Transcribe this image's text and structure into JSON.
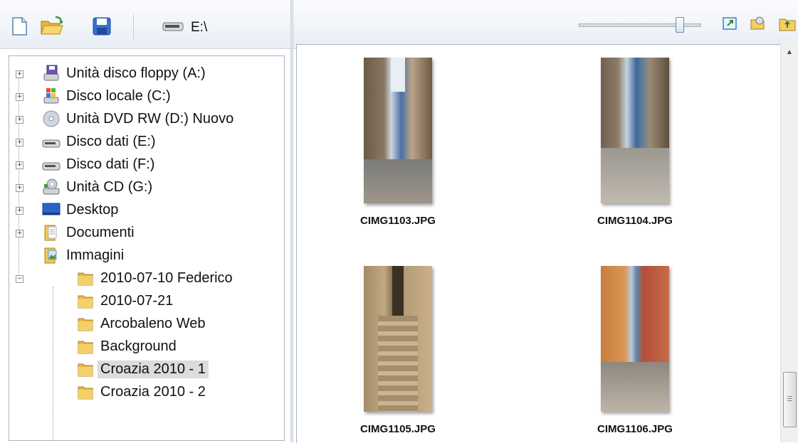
{
  "toolbar": {
    "new_icon": "new-file-icon",
    "open_icon": "open-folder-icon",
    "save_icon": "save-disk-icon",
    "drive_label": "E:\\"
  },
  "tree": {
    "items": [
      {
        "label": "Unità disco floppy (A:)",
        "icon": "floppy-drive-icon"
      },
      {
        "label": "Disco locale (C:)",
        "icon": "windows-drive-icon"
      },
      {
        "label": "Unità DVD RW (D:) Nuovo",
        "icon": "dvd-drive-icon"
      },
      {
        "label": "Disco dati (E:)",
        "icon": "hard-drive-icon"
      },
      {
        "label": "Disco dati (F:)",
        "icon": "hard-drive-icon"
      },
      {
        "label": "Unità CD (G:)",
        "icon": "cd-drive-icon"
      },
      {
        "label": "Desktop",
        "icon": "desktop-icon"
      },
      {
        "label": "Documenti",
        "icon": "documents-folder-icon"
      },
      {
        "label": "Immagini",
        "icon": "pictures-folder-icon"
      },
      {
        "label": "2010-07-10 Federico",
        "icon": "folder-icon"
      },
      {
        "label": "2010-07-21",
        "icon": "folder-icon"
      },
      {
        "label": "Arcobaleno Web",
        "icon": "folder-icon"
      },
      {
        "label": "Background",
        "icon": "folder-icon"
      },
      {
        "label": "Croazia 2010 - 1",
        "icon": "folder-icon",
        "selected": true
      },
      {
        "label": "Croazia 2010 - 2",
        "icon": "folder-icon"
      }
    ]
  },
  "viewer": {
    "zoom_slider_value": 0.85,
    "thumbnails": [
      {
        "caption": "CIMG1103.JPG"
      },
      {
        "caption": "CIMG1104.JPG"
      },
      {
        "caption": "CIMG1105.JPG"
      },
      {
        "caption": "CIMG1106.JPG"
      }
    ]
  },
  "colors": {
    "toolbar_bg": "#e9eef5",
    "selection_bg": "#dcdcdc",
    "border": "#a9b3bf"
  }
}
